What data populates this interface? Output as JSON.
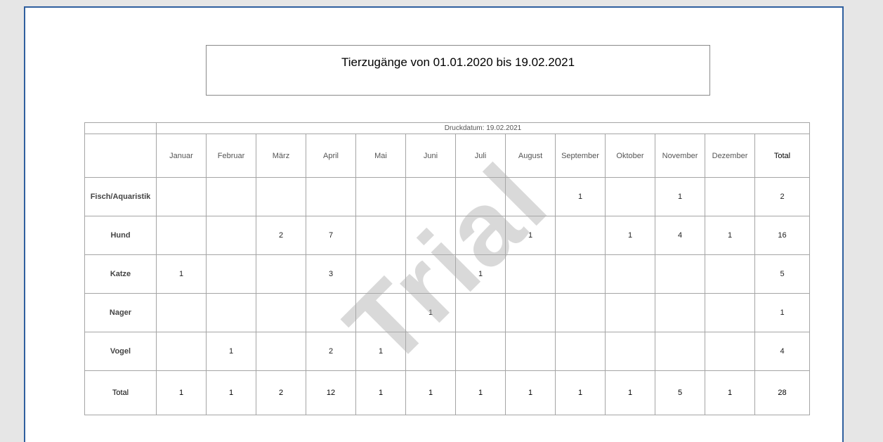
{
  "report": {
    "title": "Tierzugänge von 01.01.2020 bis 19.02.2021",
    "print_date": "Druckdatum: 19.02.2021",
    "watermark": "Trial"
  },
  "table": {
    "columns": [
      "Januar",
      "Februar",
      "März",
      "April",
      "Mai",
      "Juni",
      "Juli",
      "August",
      "September",
      "Oktober",
      "November",
      "Dezember",
      "Total"
    ],
    "rows": [
      {
        "label": "Fisch/Aquaristik",
        "values": [
          "",
          "",
          "",
          "",
          "",
          "",
          "",
          "",
          "1",
          "",
          "1",
          "",
          "2"
        ]
      },
      {
        "label": "Hund",
        "values": [
          "",
          "",
          "2",
          "7",
          "",
          "",
          "",
          "1",
          "",
          "1",
          "4",
          "1",
          "16"
        ]
      },
      {
        "label": "Katze",
        "values": [
          "1",
          "",
          "",
          "3",
          "",
          "",
          "1",
          "",
          "",
          "",
          "",
          "",
          "5"
        ]
      },
      {
        "label": "Nager",
        "values": [
          "",
          "",
          "",
          "",
          "",
          "1",
          "",
          "",
          "",
          "",
          "",
          "",
          "1"
        ]
      },
      {
        "label": "Vogel",
        "values": [
          "",
          "1",
          "",
          "2",
          "1",
          "",
          "",
          "",
          "",
          "",
          "",
          "",
          "4"
        ]
      }
    ],
    "total_row": {
      "label": "Total",
      "values": [
        "1",
        "1",
        "2",
        "12",
        "1",
        "1",
        "1",
        "1",
        "1",
        "1",
        "5",
        "1",
        "28"
      ]
    }
  },
  "colors": {
    "page_border": "#2f5f9e",
    "background": "#e6e6e6",
    "grid": "#a5a5a5"
  }
}
